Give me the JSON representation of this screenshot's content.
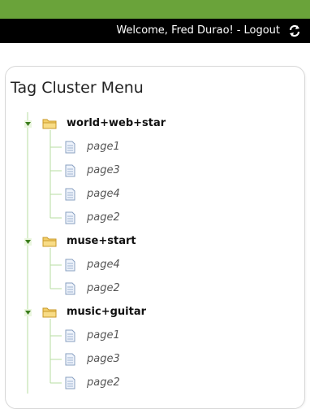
{
  "header": {
    "welcome": "Welcome, Fred Durao!",
    "separator": "-",
    "logout": "Logout",
    "refresh_icon": "refresh-icon",
    "colors": {
      "top_strip": "#6aa33a",
      "bar": "#000000"
    }
  },
  "menu": {
    "title": "Tag Cluster Menu",
    "clusters": [
      {
        "label": "world+web+star",
        "pages": [
          "page1",
          "page3",
          "page4",
          "page2"
        ]
      },
      {
        "label": "muse+start",
        "pages": [
          "page4",
          "page2"
        ]
      },
      {
        "label": "music+guitar",
        "pages": [
          "page1",
          "page3",
          "page2"
        ]
      }
    ]
  }
}
